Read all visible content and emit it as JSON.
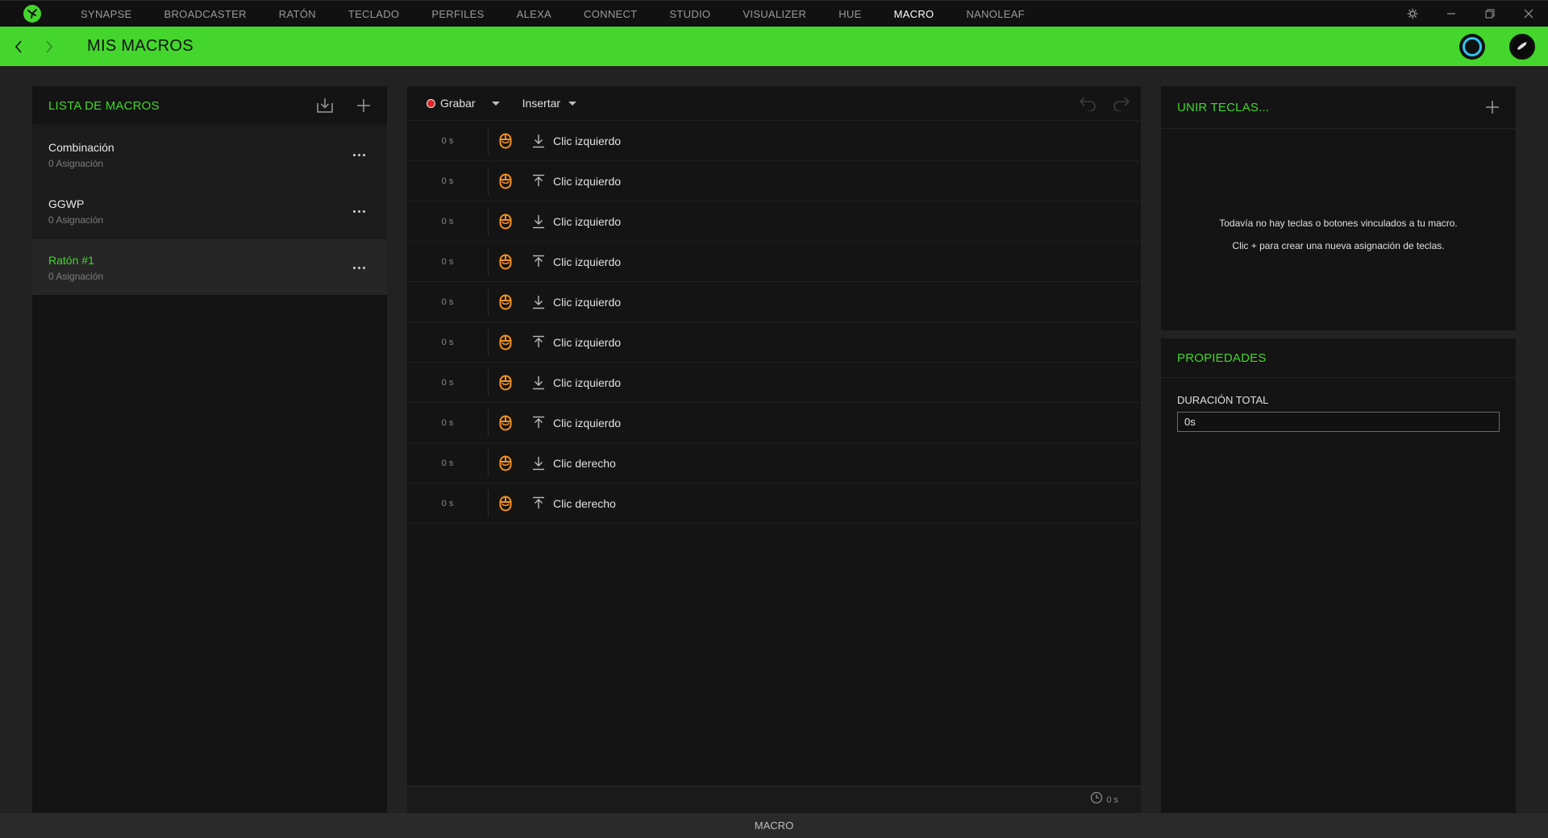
{
  "nav": {
    "items": [
      "SYNAPSE",
      "BROADCASTER",
      "RATÓN",
      "TECLADO",
      "PERFILES",
      "ALEXA",
      "CONNECT",
      "STUDIO",
      "VISUALIZER",
      "HUE",
      "MACRO",
      "NANOLEAF"
    ],
    "active": "MACRO"
  },
  "header": {
    "title": "MIS MACROS"
  },
  "macro_list": {
    "title": "LISTA DE MACROS",
    "items": [
      {
        "name": "Combinación",
        "sub": "0 Asignación"
      },
      {
        "name": "GGWP",
        "sub": "0 Asignación"
      },
      {
        "name": "Ratón #1",
        "sub": "0 Asignación"
      }
    ]
  },
  "editor": {
    "record_label": "Grabar",
    "insert_label": "Insertar",
    "rows": [
      {
        "time": "0 s",
        "dir": "down",
        "action": "Clic izquierdo"
      },
      {
        "time": "0 s",
        "dir": "up",
        "action": "Clic izquierdo"
      },
      {
        "time": "0 s",
        "dir": "down",
        "action": "Clic izquierdo"
      },
      {
        "time": "0 s",
        "dir": "up",
        "action": "Clic izquierdo"
      },
      {
        "time": "0 s",
        "dir": "down",
        "action": "Clic izquierdo"
      },
      {
        "time": "0 s",
        "dir": "up",
        "action": "Clic izquierdo"
      },
      {
        "time": "0 s",
        "dir": "down",
        "action": "Clic izquierdo"
      },
      {
        "time": "0 s",
        "dir": "up",
        "action": "Clic izquierdo"
      },
      {
        "time": "0 s",
        "dir": "down",
        "action": "Clic derecho"
      },
      {
        "time": "0 s",
        "dir": "up",
        "action": "Clic derecho"
      }
    ],
    "total_time": "0 s"
  },
  "bindings": {
    "title": "UNIR TECLAS...",
    "empty_line1": "Todavía no hay teclas o botones vinculados a tu macro.",
    "empty_line2": "Clic + para crear una nueva asignación de teclas."
  },
  "properties": {
    "title": "PROPIEDADES",
    "duration_label": "DURACIÓN TOTAL",
    "duration_value": "0s"
  },
  "statusbar": {
    "label": "MACRO"
  },
  "colors": {
    "accent": "#44d62c",
    "mouse_icon": "#f7931e",
    "record": "#e0252b"
  }
}
